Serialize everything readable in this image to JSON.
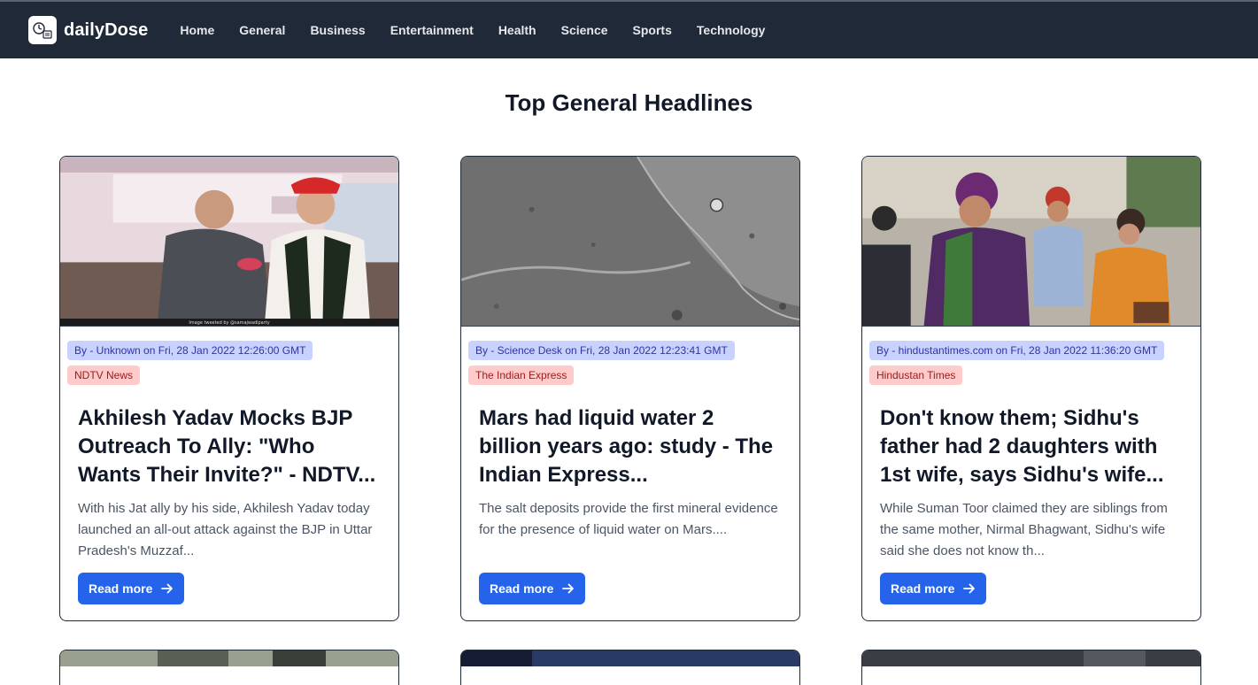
{
  "nav": {
    "brand": "dailyDose",
    "links": [
      "Home",
      "General",
      "Business",
      "Entertainment",
      "Health",
      "Science",
      "Sports",
      "Technology"
    ]
  },
  "page": {
    "title": "Top General Headlines"
  },
  "articles": [
    {
      "meta": "By - Unknown on Fri, 28 Jan 2022 12:26:00 GMT",
      "source": "NDTV News",
      "title": "Akhilesh Yadav Mocks BJP Outreach To Ally: \"Who Wants Their Invite?\" - NDTV...",
      "description": "With his Jat ally by his side, Akhilesh Yadav today launched an all-out attack against the BJP in Uttar Pradesh's Muzzaf...",
      "button": "Read more",
      "image_caption": "Image tweeted by @samajwadiparty"
    },
    {
      "meta": "By - Science Desk on Fri, 28 Jan 2022 12:23:41 GMT",
      "source": "The Indian Express",
      "title": "Mars had liquid water 2 billion years ago: study - The Indian Express...",
      "description": "The salt deposits provide the first mineral evidence for the presence of liquid water on Mars....",
      "button": "Read more"
    },
    {
      "meta": "By - hindustantimes.com on Fri, 28 Jan 2022 11:36:20 GMT",
      "source": "Hindustan Times",
      "title": "Don't know them; Sidhu's father had 2 daughters with 1st wife, says Sidhu's wife...",
      "description": "While Suman Toor claimed they are siblings from the same mother, Nirmal Bhagwant, Sidhu's wife said she does not know th...",
      "button": "Read more"
    }
  ],
  "colors": {
    "navbar": "#1f2937",
    "meta_badge": "#c7d2fe",
    "source_badge": "#fecaca",
    "button": "#2563eb"
  }
}
